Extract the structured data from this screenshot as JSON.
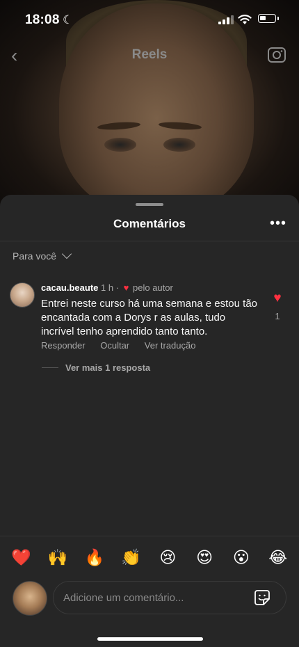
{
  "status_bar": {
    "time": "18:08"
  },
  "header": {
    "title": "Reels"
  },
  "sheet": {
    "title": "Comentários",
    "filter_label": "Para você"
  },
  "comment": {
    "username": "cacau.beaute",
    "time": "1 h",
    "separator": "·",
    "liked_by_author": "pelo autor",
    "text": "Entrei neste  curso há uma semana e estou tão encantada com a Dorys r as aulas, tudo incrível tenho aprendido tanto tanto.",
    "like_count": "1",
    "actions": {
      "reply": "Responder",
      "hide": "Ocultar",
      "translate": "Ver tradução"
    },
    "view_replies": "Ver mais 1 resposta"
  },
  "emoji_bar": [
    "❤️",
    "🙌",
    "🔥",
    "👏",
    "😢",
    "😍",
    "😮",
    "😂"
  ],
  "composer": {
    "placeholder": "Adicione um comentário..."
  },
  "colors": {
    "sheet_bg": "#262626",
    "like_red": "#ff3040",
    "muted_text": "#a8a8a8"
  }
}
